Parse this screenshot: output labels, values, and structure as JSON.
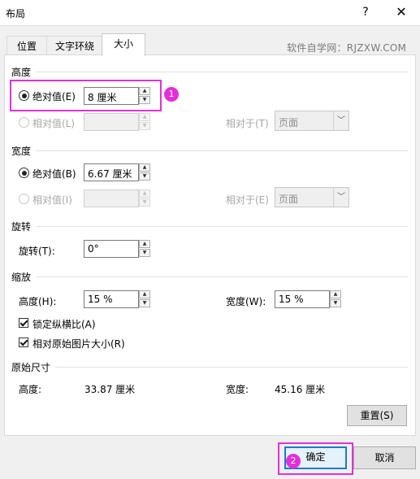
{
  "window": {
    "title": "布局",
    "help": "?",
    "close": "✕"
  },
  "tabs": [
    {
      "label": "位置"
    },
    {
      "label": "文字环绕"
    },
    {
      "label": "大小"
    }
  ],
  "watermark": "软件自学网：RJZXW.COM",
  "height": {
    "section": "高度",
    "absolute": {
      "label": "绝对值(E)",
      "value": "8 厘米"
    },
    "relative": {
      "label": "相对值(L)",
      "value": "",
      "relative_to_label": "相对于(T)",
      "relative_to_value": "页面"
    }
  },
  "width": {
    "section": "宽度",
    "absolute": {
      "label": "绝对值(B)",
      "value": "6.67 厘米"
    },
    "relative": {
      "label": "相对值(I)",
      "value": "",
      "relative_to_label": "相对于(E)",
      "relative_to_value": "页面"
    }
  },
  "rotation": {
    "section": "旋转",
    "label": "旋转(T):",
    "value": "0°"
  },
  "scale": {
    "section": "缩放",
    "height_label": "高度(H):",
    "height_value": "15 %",
    "width_label": "宽度(W):",
    "width_value": "15 %",
    "lock_aspect": "锁定纵横比(A)",
    "relative_original": "相对原始图片大小(R)"
  },
  "original": {
    "section": "原始尺寸",
    "height_label": "高度:",
    "height_value": "33.87 厘米",
    "width_label": "宽度:",
    "width_value": "45.16 厘米"
  },
  "buttons": {
    "reset": "重置(S)",
    "ok": "确定",
    "cancel": "取消"
  },
  "annotations": {
    "badge1": "1",
    "badge2": "2"
  },
  "colors": {
    "highlight": "#e42fd8",
    "default_button_border": "#1a7bd0"
  }
}
